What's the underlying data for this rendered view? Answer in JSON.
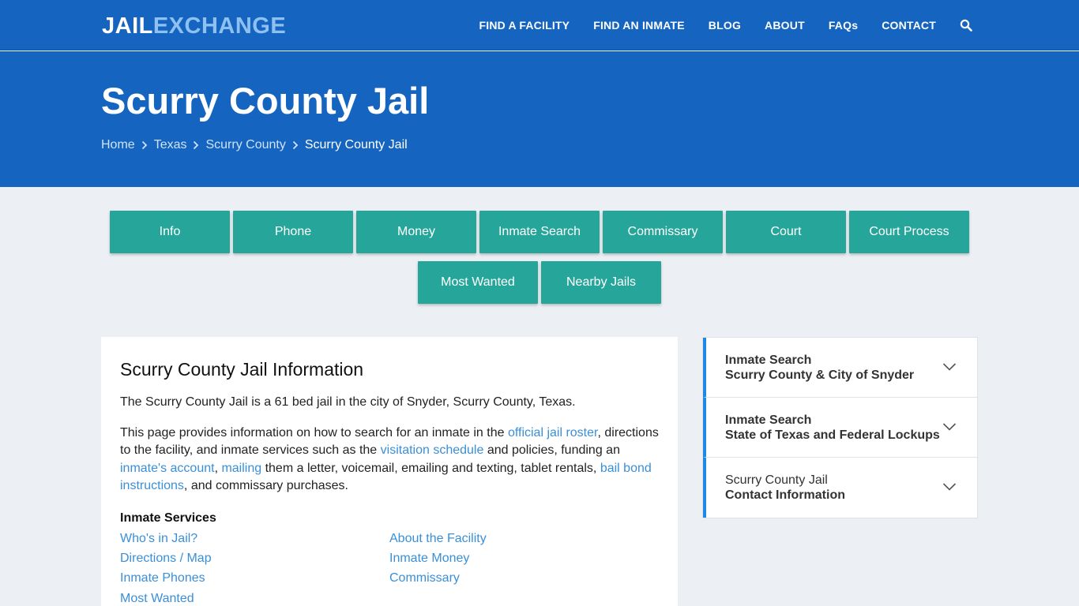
{
  "header": {
    "logo_part1": "JAIL",
    "logo_part2": "EXCHANGE",
    "nav": [
      "FIND A FACILITY",
      "FIND AN INMATE",
      "BLOG",
      "ABOUT",
      "FAQs",
      "CONTACT"
    ],
    "search_icon": "search-icon"
  },
  "hero": {
    "title": "Scurry County Jail",
    "breadcrumbs": [
      "Home",
      "Texas",
      "Scurry County",
      "Scurry County Jail"
    ]
  },
  "tabs": {
    "row1": [
      "Info",
      "Phone",
      "Money",
      "Inmate Search",
      "Commissary",
      "Court",
      "Court Process"
    ],
    "row2": [
      "Most Wanted",
      "Nearby Jails"
    ]
  },
  "main": {
    "title": "Scurry County Jail Information",
    "intro": "The Scurry County Jail is a 61 bed jail in the city of Snyder, Scurry County, Texas.",
    "para": {
      "t1": "This page provides information on how to search for an inmate in the ",
      "l1": "official jail roster",
      "t2": ", directions to the facility, and inmate services such as the ",
      "l2": "visitation schedule",
      "t3": " and policies, funding an ",
      "l3": "inmate's account",
      "t4": ", ",
      "l4": "mailing",
      "t5": " them a letter, voicemail, emailing and texting, tablet rentals, ",
      "l5": "bail bond instructions",
      "t6": ", and commissary purchases."
    },
    "services_title": "Inmate Services",
    "services": [
      "Who's in Jail?",
      "About the Facility",
      "Directions / Map",
      "Inmate Money",
      "Inmate Phones",
      "Commissary",
      "Most Wanted"
    ]
  },
  "sidebar": {
    "items": [
      {
        "line1": "Inmate Search",
        "line2": "Scurry County & City of Snyder"
      },
      {
        "line1": "Inmate Search",
        "line2": "State of Texas and Federal Lockups"
      },
      {
        "line1": "Scurry County Jail",
        "line2": "Contact Information"
      }
    ]
  },
  "colors": {
    "primary": "#1565c0",
    "tab": "#26a69a",
    "link": "#3a8fd8",
    "logo_accent": "#8ec0f2"
  }
}
